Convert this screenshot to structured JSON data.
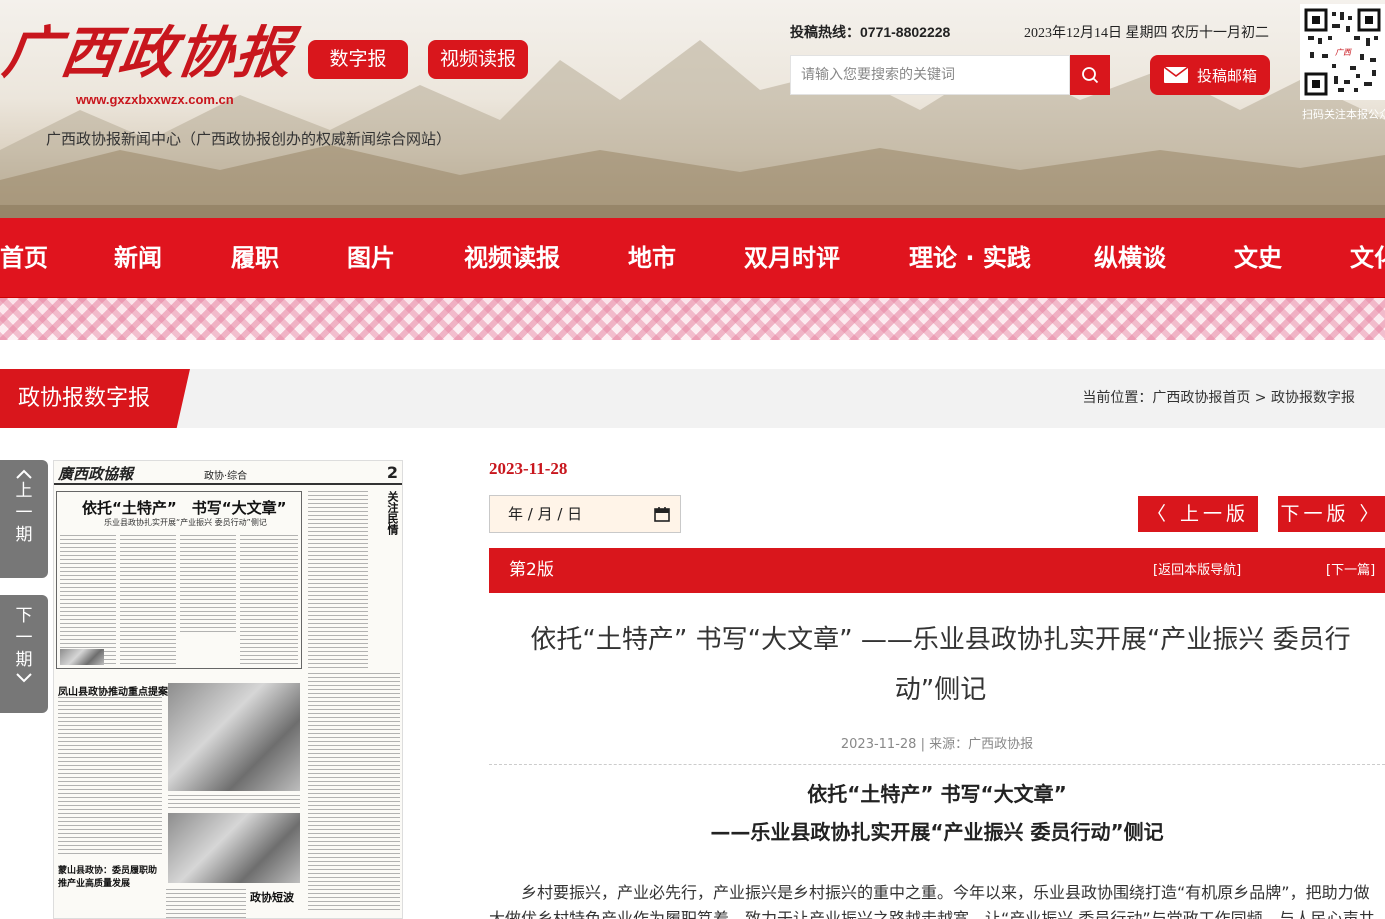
{
  "header": {
    "logo_text": "广西政协报",
    "logo_url": "www.gxzxbxxwzx.com.cn",
    "site_desc": "广西政协报新闻中心（广西政协报创办的权威新闻综合网站）",
    "btn_digital": "数字报",
    "btn_video": "视频读报",
    "hotline": "投稿热线：0771-8802228",
    "date_text": "2023年12月14日 星期四 农历十一月初二",
    "search_placeholder": "请输入您要搜索的关键词",
    "mail_label": "投稿邮箱",
    "qr_caption": "扫码关注本报公众"
  },
  "nav": {
    "items": [
      "首页",
      "新闻",
      "履职",
      "图片",
      "视频读报",
      "地市",
      "双月时评",
      "理论 · 实践",
      "纵横谈",
      "文史",
      "文化"
    ]
  },
  "section": {
    "title": "政协报数字报",
    "breadcrumb": "当前位置：广西政协报首页 > 政协报数字报"
  },
  "side": {
    "prev": [
      "上",
      "一",
      "期"
    ],
    "next": [
      "下",
      "一",
      "期"
    ]
  },
  "paper": {
    "logo": "廣西政協報",
    "section": "政协·综合",
    "page_num": "2",
    "headline": "依托“土特产”　书写“大文章”",
    "subhead": "乐业县政协扎实开展“产业振兴 委员行动”侧记",
    "box2_head": "凤山县政协推动重点提案落地见效",
    "sub3": "蒙山县政协：委员履职助推产业高质量发展",
    "brief": "政协短波"
  },
  "article": {
    "pub_date": "2023-11-28",
    "date_input": "年 / 月 / 日",
    "prev_page": "〈 上一版",
    "next_page": "下一版 〉",
    "edition": "第2版",
    "back_nav": "[返回本版导航]",
    "next_article": "[下一篇]",
    "title": "依托“土特产” 书写“大文章” ——乐业县政协扎实开展“产业振兴 委员行动”侧记",
    "meta": "2023-11-28 | 来源：广西政协报",
    "heading1": "依托“土特产” 书写“大文章”",
    "heading2": "——乐业县政协扎实开展“产业振兴 委员行动”侧记",
    "body": "乡村要振兴，产业必先行，产业振兴是乡村振兴的重中之重。今年以来，乐业县政协围绕打造“有机原乡品牌”，把助力做大做优乡村特色产业作为履职笃着，致力于让产业振兴之路越走越宽，让“产业振兴 委员行动”与党政工作同频，与人民心声共振。"
  },
  "colors": {
    "brand_red": "#d9161c",
    "nav_red": "#e0141e",
    "date_red": "#c8161d",
    "side_gray": "#777777"
  }
}
